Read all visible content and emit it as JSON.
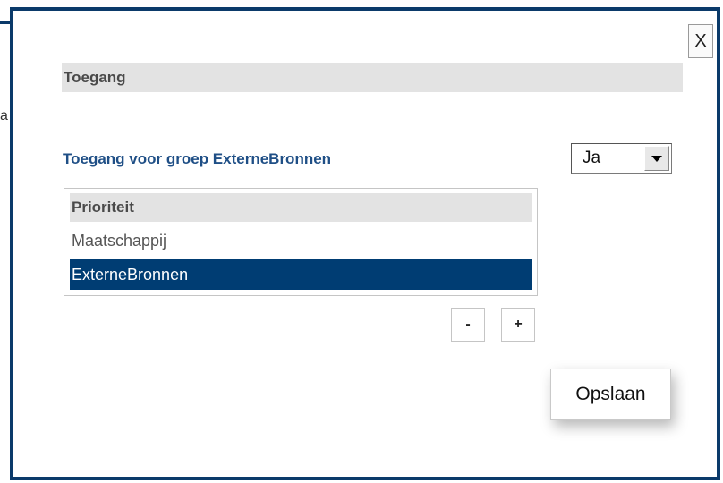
{
  "dialog": {
    "close_label": "X",
    "section_title": "Toegang",
    "access": {
      "label": "Toegang voor groep ExterneBronnen",
      "select_value": "Ja"
    },
    "priority": {
      "header": "Prioriteit",
      "rows": [
        "Maatschappij",
        "ExterneBronnen"
      ],
      "selected_index": 1
    },
    "buttons": {
      "minus": "-",
      "plus": "+",
      "save": "Opslaan"
    }
  },
  "background": {
    "letter": "a"
  },
  "colors": {
    "frame": "#0b3a6a",
    "label_blue": "#1f4f86",
    "selected_row": "#003d73",
    "header_gray": "#e3e3e3"
  },
  "icons": {
    "dropdown_arrow": "chevron-down-icon",
    "close": "close-icon"
  }
}
